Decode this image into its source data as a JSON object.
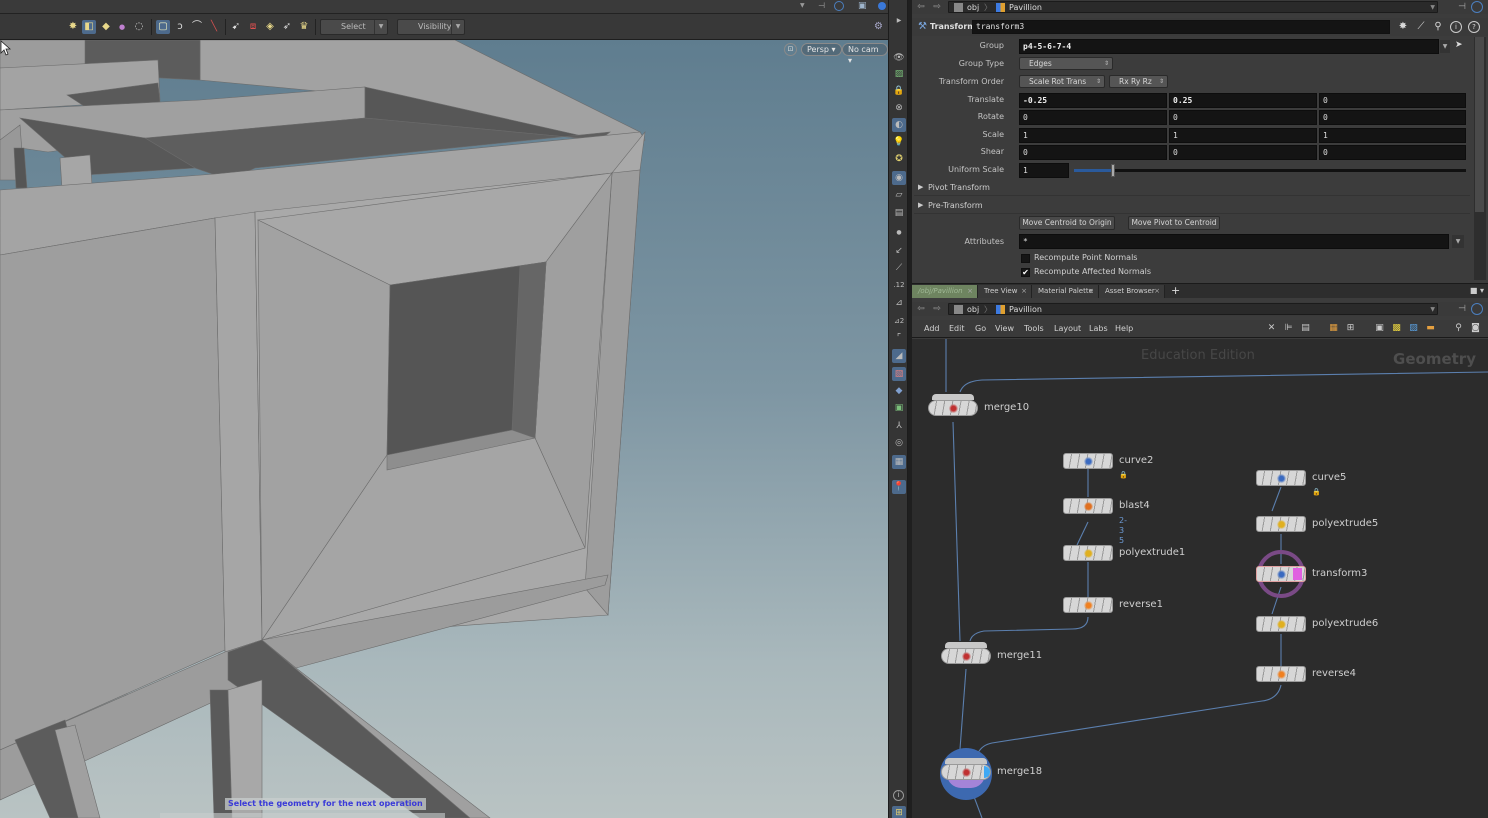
{
  "viewport": {
    "toolbar": {
      "select_mode": "Select",
      "visibility": "Visibility",
      "icons": [
        "select-points-icon",
        "select-primitives-icon",
        "select-edges-icon",
        "select-vertices-icon",
        "select-breakpoints-icon",
        "box-select-icon",
        "lasso-select-icon",
        "brush-select-icon",
        "laser-select-icon",
        "select-visible-icon",
        "select-grouped-icon",
        "secure-selection-icon",
        "select-whole-geometry-icon",
        "select-connected-icon"
      ]
    },
    "camera_menu": "Persp ▾",
    "camera_select": "No cam ▾",
    "status_message": "Select the geometry for the next operation"
  },
  "path_top": {
    "root": "obj",
    "node": "Pavillion"
  },
  "params": {
    "node_type": "Transform",
    "node_name": "transform3",
    "group_label": "Group",
    "group_value": "p4-5-6-7-4",
    "group_type_label": "Group Type",
    "group_type_value": "Edges",
    "transform_order_label": "Transform Order",
    "transform_order_value": "Scale Rot Trans",
    "rotation_order_value": "Rx Ry Rz",
    "translate_label": "Translate",
    "translate": [
      "-0.25",
      "0.25",
      "0"
    ],
    "rotate_label": "Rotate",
    "rotate": [
      "0",
      "0",
      "0"
    ],
    "scale_label": "Scale",
    "scale": [
      "1",
      "1",
      "1"
    ],
    "shear_label": "Shear",
    "shear": [
      "0",
      "0",
      "0"
    ],
    "uniform_scale_label": "Uniform Scale",
    "uniform_scale": "1",
    "uniform_scale_slider_fraction": 0.1,
    "pivot_transform_label": "Pivot Transform",
    "pre_transform_label": "Pre-Transform",
    "move_centroid_button": "Move Centroid to Origin",
    "move_pivot_button": "Move Pivot to Centroid",
    "attributes_label": "Attributes",
    "attributes_value": "*",
    "recompute_point_normals_label": "Recompute Point Normals",
    "recompute_point_normals": false,
    "recompute_affected_normals_label": "Recompute Affected Normals",
    "recompute_affected_normals": true
  },
  "tabs": [
    {
      "label": "/obj/Pavillion",
      "active": true
    },
    {
      "label": "Tree View",
      "active": false
    },
    {
      "label": "Material Palette",
      "active": false
    },
    {
      "label": "Asset Browser",
      "active": false
    }
  ],
  "path_network": {
    "root": "obj",
    "node": "Pavillion"
  },
  "network_menu": [
    "Add",
    "Edit",
    "Go",
    "View",
    "Tools",
    "Layout",
    "Labs",
    "Help"
  ],
  "network": {
    "watermark_edition": "Education Edition",
    "watermark_context": "Geometry",
    "nodes": [
      {
        "name": "merge10",
        "type": "merge"
      },
      {
        "name": "curve2",
        "type": "curve",
        "locked": true
      },
      {
        "name": "blast4",
        "type": "blast",
        "sublabel": "2-3 5"
      },
      {
        "name": "polyextrude1",
        "type": "polyextrude"
      },
      {
        "name": "reverse1",
        "type": "reverse"
      },
      {
        "name": "merge11",
        "type": "merge"
      },
      {
        "name": "curve5",
        "type": "curve",
        "locked": true
      },
      {
        "name": "polyextrude5",
        "type": "polyextrude"
      },
      {
        "name": "transform3",
        "type": "transform",
        "selected": true
      },
      {
        "name": "polyextrude6",
        "type": "polyextrude"
      },
      {
        "name": "reverse4",
        "type": "reverse"
      },
      {
        "name": "merge18",
        "type": "merge",
        "display": true
      }
    ]
  },
  "colors": {
    "accent_blue": "#4d6a8c",
    "status_text": "#3a3ad8",
    "active_tab": "#6e8460",
    "selected_ring": "#7a4a86",
    "display_flag": "#3fa9f5",
    "wire": "#5b7fae"
  }
}
